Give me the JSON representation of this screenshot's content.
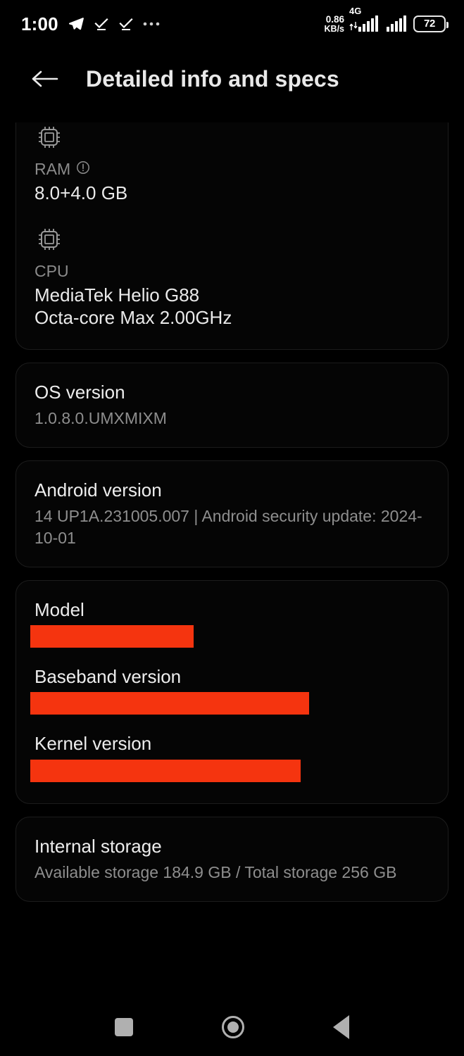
{
  "status_bar": {
    "clock": "1:00",
    "icons": [
      "telegram-icon",
      "check-underline-icon",
      "check-underline-icon",
      "ellipsis-icon"
    ],
    "net_speed_value": "0.86",
    "net_speed_unit": "KB/s",
    "network_type": "4G",
    "battery_percent": "72"
  },
  "app_bar": {
    "back_label": "back-arrow",
    "title": "Detailed info and specs"
  },
  "cards": {
    "hardware": {
      "ram": {
        "label": "RAM",
        "info_icon": "info-icon",
        "value": "8.0+4.0 GB"
      },
      "cpu": {
        "label": "CPU",
        "value_line1": "MediaTek Helio G88",
        "value_line2": "Octa-core Max 2.00GHz"
      }
    },
    "os_version": {
      "title": "OS version",
      "value": "1.0.8.0.UMXMIXM"
    },
    "android_version": {
      "title": "Android version",
      "value": "14 UP1A.231005.007 | Android security update: 2024-10-01"
    },
    "identifiers": {
      "model": {
        "title": "Model",
        "value": "",
        "redacted": true
      },
      "baseband": {
        "title": "Baseband version",
        "value": "",
        "redacted": true
      },
      "kernel": {
        "title": "Kernel version",
        "value": "",
        "redacted": true
      }
    },
    "internal_storage": {
      "title": "Internal storage",
      "value": "Available storage  184.9 GB / Total storage  256 GB"
    }
  },
  "nav_bar": {
    "recents": "recents-button",
    "home": "home-button",
    "back": "back-button"
  },
  "colors": {
    "redaction": "#f5340f",
    "background": "#000000",
    "card_border": "#1c1c1c",
    "primary_text": "#eaeaea",
    "secondary_text": "#8b8b8b"
  }
}
